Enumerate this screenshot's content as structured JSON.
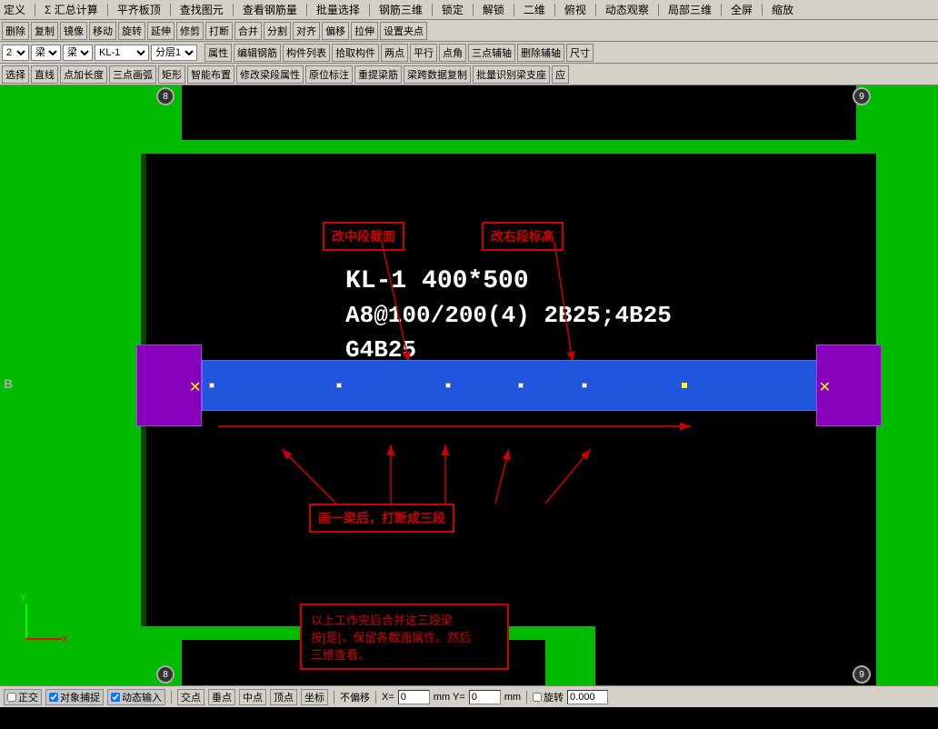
{
  "menu": {
    "items": [
      "定义",
      "Σ 汇总计算",
      "平齐板顶",
      "查找图元",
      "查看钢筋量",
      "批量选择",
      "钢筋三维",
      "锁定",
      "解锁",
      "二维",
      "俯视",
      "动态观察",
      "局部三维",
      "全屏",
      "缩放"
    ]
  },
  "toolbar1": {
    "buttons": [
      "删除",
      "复制",
      "镜像",
      "移动",
      "旋转",
      "延伸",
      "修剪",
      "打断",
      "合并",
      "分割",
      "对齐",
      "偏移",
      "拉伸",
      "设置夹点"
    ]
  },
  "toolbar2": {
    "selects": [
      "2",
      "梁",
      "梁",
      "KL-1",
      "分层1"
    ],
    "buttons": [
      "属性",
      "编辑钢筋",
      "构件列表",
      "拾取构件",
      "两点",
      "平行",
      "点角",
      "三点辅轴",
      "删除辅轴",
      "尺寸"
    ]
  },
  "toolbar3": {
    "buttons": [
      "选择",
      "直线",
      "点加长度",
      "三点画弧",
      "矩形",
      "智能布置",
      "修改梁段属性",
      "原位标注",
      "重提梁筋",
      "梁跨数据复制",
      "批量识别梁支座",
      "应"
    ]
  },
  "canvas": {
    "beam_label_line1": "KL-1 400*500",
    "beam_label_line2": "A8@100/200(4) 2B25;4B25",
    "beam_label_line3": "G4B25",
    "annotation1": "改中段截面",
    "annotation2": "改右段标高",
    "annotation3": "画一梁后，打断成三段",
    "annotation4_line1": "以上工作完后合并这三段梁",
    "annotation4_line2": "按[是]，保留各截面属性。然后",
    "annotation4_line3": "三维查看。",
    "grid_nums": [
      "8",
      "9",
      "8",
      "9"
    ],
    "coord_x": "X",
    "coord_y": "Y"
  },
  "statusbar": {
    "items": [
      "正交",
      "对象捕捉",
      "动态输入",
      "交点",
      "垂点",
      "中点",
      "顶点",
      "坐标",
      "不偏移",
      "X=",
      "0",
      "mm Y=",
      "0",
      "mm",
      "旋转",
      "0.000"
    ]
  }
}
